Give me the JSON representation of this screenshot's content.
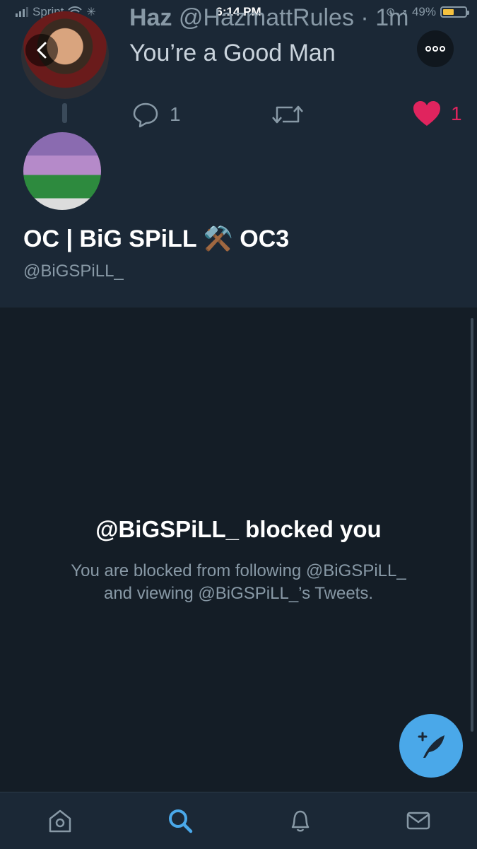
{
  "status_bar": {
    "carrier": "Sprint",
    "time": "6:14 PM",
    "battery_percent": "49%",
    "battery_level": 0.49,
    "icons": [
      "signal-icon",
      "wifi-icon",
      "loading-icon",
      "orientation-lock-icon",
      "location-icon",
      "battery-icon"
    ]
  },
  "tweet": {
    "author_name": "Haz",
    "author_handle": "@HazmattRules",
    "separator": "·",
    "age": "1m",
    "text": "You’re a Good Man",
    "reply_count": "1",
    "like_count": "1"
  },
  "profile": {
    "display_name": "OC | BiG SPiLL ⚒️ OC3",
    "handle": "@BiGSPiLL_"
  },
  "blocked": {
    "title": "@BiGSPiLL_ blocked you",
    "line1": "You are blocked from following @BiGSPiLL_",
    "line2": "and viewing @BiGSPiLL_’s Tweets."
  },
  "tab_bar": {
    "items": [
      "home-icon",
      "search-icon",
      "notifications-icon",
      "messages-icon"
    ],
    "active": "search-icon"
  },
  "colors": {
    "background": "#141d26",
    "header": "#1b2836",
    "accent": "#4aa8e9",
    "like": "#e0245e",
    "muted": "#8899a6"
  }
}
